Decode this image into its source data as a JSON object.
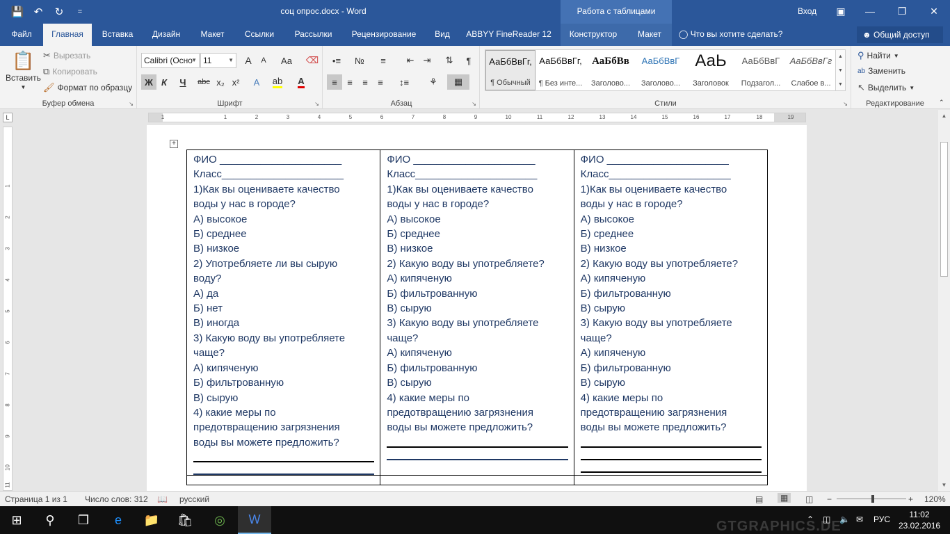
{
  "window": {
    "title": "соц опрос.docx - Word",
    "context_tab_group": "Работа с таблицами",
    "signin": "Вход",
    "qat_customize": "="
  },
  "tabs": [
    "Файл",
    "Главная",
    "Вставка",
    "Дизайн",
    "Макет",
    "Ссылки",
    "Рассылки",
    "Рецензирование",
    "Вид",
    "ABBYY FineReader 12",
    "Конструктор",
    "Макет"
  ],
  "active_tab": "Главная",
  "tell_me": "Что вы хотите сделать?",
  "share": "Общий доступ",
  "ribbon": {
    "clipboard": {
      "label": "Буфер обмена",
      "paste": "Вставить",
      "cut": "Вырезать",
      "copy": "Копировать",
      "format_painter": "Формат по образцу"
    },
    "font": {
      "label": "Шрифт",
      "font_name": "Calibri (Осно",
      "font_size": "11",
      "bold": "Ж",
      "italic": "К",
      "underline": "Ч",
      "strike": "abc",
      "subscript": "x₂",
      "superscript": "x²",
      "change_case": "Aa",
      "text_effects": "A",
      "highlight": "ab",
      "font_color": "A",
      "grow": "A",
      "shrink": "A"
    },
    "paragraph": {
      "label": "Абзац"
    },
    "styles": {
      "label": "Стили",
      "items": [
        {
          "sample": "АаБбВвГг,",
          "name": "¶ Обычный"
        },
        {
          "sample": "АаБбВвГг,",
          "name": "¶ Без инте..."
        },
        {
          "sample": "АаБбВв",
          "name": "Заголово..."
        },
        {
          "sample": "АаБбВвГ",
          "name": "Заголово..."
        },
        {
          "sample": "АаЬ",
          "name": "Заголовок"
        },
        {
          "sample": "АаБбВвГ",
          "name": "Подзагол..."
        },
        {
          "sample": "АаБбВвГг",
          "name": "Слабое в..."
        }
      ]
    },
    "editing": {
      "label": "Редактирование",
      "find": "Найти",
      "replace": "Заменить",
      "select": "Выделить"
    }
  },
  "ruler": {
    "h_ticks": [
      "1",
      "1",
      "2",
      "3",
      "4",
      "5",
      "6",
      "7",
      "8",
      "9",
      "10",
      "11",
      "12",
      "13",
      "14",
      "15",
      "16",
      "17",
      "18",
      "19"
    ],
    "v_ticks": [
      "1",
      "2",
      "3",
      "4",
      "5",
      "6",
      "7",
      "8",
      "9",
      "10",
      "11"
    ],
    "tab_selector": "L"
  },
  "document": {
    "columns": [
      {
        "lines": [
          "ФИО _____________________",
          "Класс_____________________",
          "1)Как вы оцениваете качество",
          "воды у нас в городе?",
          "А) высокое",
          "Б) среднее",
          "В) низкое",
          "2) Употребляете ли вы сырую",
          "воду?",
          "А) да",
          "Б) нет",
          "В) иногда",
          "3) Какую воду вы употребляете",
          "чаще?",
          "А) кипяченую",
          "Б) фильтрованную",
          "В) сырую",
          "4) какие меры по",
          "предотвращению загрязнения",
          "воды вы можете предложить?"
        ]
      },
      {
        "lines": [
          "ФИО _____________________",
          "Класс_____________________",
          "1)Как вы оцениваете качество",
          "воды у нас в городе?",
          "А) высокое",
          "Б) среднее",
          "В) низкое",
          "2) Какую воду вы употребляете?",
          "А) кипяченую",
          "Б) фильтрованную",
          "В) сырую",
          "3) Какую воду вы употребляете",
          "чаще?",
          "А) кипяченую",
          "Б) фильтрованную",
          "В) сырую",
          "4) какие меры по",
          "предотвращению загрязнения",
          "воды вы можете предложить?"
        ]
      },
      {
        "lines": [
          "ФИО _____________________",
          "Класс_____________________",
          "1)Как вы оцениваете качество",
          "воды у нас в городе?",
          "А) высокое",
          "Б) среднее",
          "В) низкое",
          "2) Какую воду вы употребляете?",
          "А) кипяченую",
          "Б) фильтрованную",
          "В) сырую",
          "3) Какую воду вы употребляете",
          "чаще?",
          "А) кипяченую",
          "Б) фильтрованную",
          "В) сырую",
          "4) какие меры по",
          "предотвращению загрязнения",
          "воды вы можете предложить?"
        ]
      }
    ],
    "text_color": "#1f3864"
  },
  "statusbar": {
    "page": "Страница 1 из 1",
    "words": "Число слов: 312",
    "language": "русский",
    "zoom": "120%",
    "zoom_minus": "−",
    "zoom_plus": "+"
  },
  "taskbar": {
    "language": "РУС",
    "time": "11:02",
    "date": "23.02.2016",
    "watermark": "GTGRAPHICS.DE"
  },
  "colors": {
    "word_blue": "#2b579a",
    "ribbon_bg": "#f3f3f3",
    "taskbar_bg": "#101010"
  }
}
